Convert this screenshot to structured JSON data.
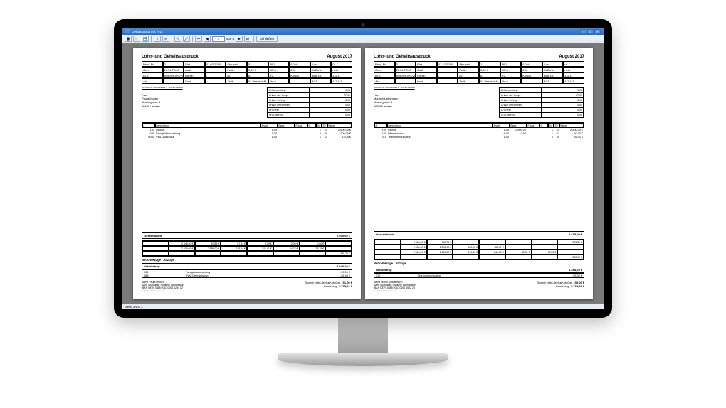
{
  "window": {
    "title": "Gehaltsausdruck (P1)",
    "close_label": "Schließen",
    "page_input": "3",
    "page_of": "von 3",
    "status": "Seite 3 von 3"
  },
  "doc_title": "Lohn- und Gehaltsausdruck",
  "period": "August 2017",
  "left": {
    "company_line": "Lohn-Firma Testmandant 1 · 66333 Landau",
    "salutation": "Frau",
    "name": "Paula Muster",
    "street": "Mustergasse 1",
    "city": "76829 Landau",
    "header_rows": [
      [
        "Pers.-Nr.",
        "2",
        "Eint.",
        "01.02.2016",
        "Steuerkl.",
        "5",
        "StKl.",
        "0,0%",
        "Konf.",
        "0"
      ],
      [
        "Geb.",
        "10.01.72/45",
        "Aust.",
        "-",
        "Freib.",
        "0,00 €",
        "KiFrb.",
        "0,0",
        "Gl.Zone",
        "nein"
      ],
      [
        "Kr.K.",
        "99999/KV+KVSatz",
        "Rente.",
        "-",
        "ID",
        "#",
        "SV",
        "Knapp.",
        "Beitr.Gr.",
        "1-1-1"
      ],
      [
        "Abt.",
        "-",
        "Kost.",
        "-",
        "Tarif",
        "01 Verwalt/MA",
        "Abr.K.",
        "-",
        "BGS",
        "111-1-1"
      ]
    ],
    "hours": [
      [
        "Ø-Stundenlohn",
        "0,00"
      ],
      [
        "Urlaub akt. Anspr.",
        "27,00"
      ],
      [
        "Urlaub Vortrag",
        "3,00"
      ],
      [
        "Urlaub genommen",
        "0,00"
      ],
      [
        "Url. Rest",
        "0,00"
      ],
      [
        "Url. Differenz",
        "0,00"
      ]
    ],
    "col_hdr": [
      "#",
      "Bezeichnung",
      "Anzahl",
      "Basis",
      "Faktor",
      "%",
      "St",
      "SV",
      "Betrag"
    ],
    "bezuege": [
      [
        "100",
        "Gehalt",
        "1,00",
        "",
        "",
        "",
        "1",
        "1",
        "2.500,00 €"
      ],
      [
        "030",
        "Fahrgeldauszahlung",
        "1,00",
        "",
        "",
        "",
        "0",
        "0",
        "200,00 €"
      ],
      [
        "0031",
        "VWL-Zuschuss",
        "1,00",
        "",
        "",
        "",
        "1",
        "1",
        "13,00 €"
      ]
    ],
    "gesamtbrutto_label": "Gesamtbrutto",
    "gesamtbrutto": "2.000,00 €",
    "deductions": [
      [
        "",
        "2.348,00 €",
        "67,84 €",
        "67,84 €",
        "0,00 €",
        "0,00 €",
        "0,00 €",
        ""
      ],
      [
        "",
        "2.609,00 €",
        "2.586,00 €",
        "118,54 €",
        "201,41 €",
        "24,72 €",
        "38,79 €",
        ""
      ],
      [
        "",
        "",
        "",
        "",
        "",
        "",
        "",
        "489,30 €"
      ]
    ],
    "netto_label": "Netto-Bezüge / Abzüge",
    "nettobetrag_lbl": "Nettobetrag",
    "nettobetrag": "4.040,10 €",
    "net_items": [
      [
        "035",
        "Fahrgeldauszahlung",
        "",
        "",
        "-13,00 €"
      ],
      [
        "0881",
        "VWL-Überweisung",
        "",
        "",
        "-26,44 €"
      ]
    ],
    "bank_name_lbl": "Name",
    "bank_name": "Paula Muster",
    "bank_lbl": "Bank",
    "bank": "Sparkasse Südliche Weinstraße",
    "iban_lbl": "IBAN",
    "iban": "DE90 5485 0010 0000 1234 12",
    "summe_lbl": "Summe Netto-Bezüge+Abzüge",
    "summe": "-51,00 €",
    "auszahlung_lbl": "Auszahlung",
    "auszahlung": "1.733,91 €",
    "footer": "Softwareofficename.com"
  },
  "right": {
    "company_line": "Lohn-Firma Testmandant 2 · 66333 Landau",
    "salutation": "Herr",
    "name": "Martin Mustermann",
    "street": "Mustergasse 1",
    "city": "76829 Landau",
    "header_rows": [
      [
        "Pers.-Nr.",
        "3",
        "Eint.",
        "01.10.2016",
        "Steuerkl.",
        "1",
        "StKl.",
        "0,0%",
        "Konf.",
        "rk"
      ],
      [
        "Geb.",
        "25.04.72/45",
        "Aust.",
        "-",
        "Freib.",
        "0,00 €",
        "KiFrb.",
        "0,0",
        "Gl.Zone",
        "nein"
      ],
      [
        "Kr.K.",
        "99999/KV+KVSatz",
        "Rente.",
        "-",
        "ID",
        "#",
        "SV",
        "Knapp.",
        "Beitr.Gr.",
        "1-1-1"
      ],
      [
        "Abt.",
        "-",
        "Kost.",
        "-",
        "Tarif",
        "01 Verwalt/MA",
        "Abr.K.",
        "-",
        "BGS",
        "111-1-1"
      ]
    ],
    "hours": [
      [
        "Ø-Stundenlohn",
        "0,00"
      ],
      [
        "Urlaub akt. Anspr.",
        "27,00"
      ],
      [
        "Urlaub Vortrag",
        "0,00"
      ],
      [
        "Urlaub genommen",
        "0,00"
      ],
      [
        "Url. Rest",
        "0,00"
      ],
      [
        "Url. Differenz",
        "0,00"
      ]
    ],
    "col_hdr": [
      "#",
      "Bezeichnung",
      "Anzahl",
      "Basis",
      "Faktor",
      "%",
      "St",
      "SV",
      "Betrag"
    ],
    "bezuege": [
      [
        "100",
        "Gehalt",
        "1,00",
        "2.500,00",
        "",
        "",
        "1",
        "1",
        "2.500,00 €"
      ],
      [
        "100",
        "Überstunden",
        "6,00",
        "10,00",
        "",
        "",
        "1",
        "1",
        "60,00 €"
      ],
      [
        "010",
        "Telekommunikation",
        "1,00",
        "",
        "",
        "",
        "0",
        "0",
        "55,00 €"
      ]
    ],
    "gesamtbrutto_label": "Gesamtbrutto",
    "gesamtbrutto": "2.615,00 €",
    "deductions": [
      [
        "",
        "2.560,00 €",
        "342,75 €",
        "",
        "",
        "",
        "",
        "375,82 €"
      ],
      [
        "",
        "2.560,00 €",
        "2.503,00 €",
        "120,60 €",
        "188,07 €",
        "",
        "",
        ""
      ],
      [
        "",
        "2.615,00 €",
        "2.615,00 €",
        "210,11 €",
        "244,30 €",
        "40,02 €",
        "40,53 €",
        ""
      ],
      [
        "",
        "",
        "",
        "",
        "",
        "",
        "",
        "530,90 €"
      ]
    ],
    "netto_label": "Netto-Bezüge / Abzüge",
    "nettobetrag_lbl": "Nettobetrag",
    "nettobetrag": "1.288,60 €",
    "net_items": [
      [
        "010",
        "Telekommunikation",
        "",
        "",
        "-55,00 €"
      ]
    ],
    "bank_name_lbl": "Name",
    "bank_name": "Martin Mustermann",
    "bank_lbl": "Bank",
    "bank": "Sparkasse Südliche Weinstraße",
    "iban_lbl": "IBAN",
    "iban": "DE70 5485 0010 0000 4562 23",
    "summe_lbl": "Summe Netto-Bezüge+Abzüge",
    "summe": "-55,00 €",
    "auszahlung_lbl": "Auszahlung",
    "auszahlung": "1.708,00 €",
    "footer": "Softwareofficename.com"
  }
}
